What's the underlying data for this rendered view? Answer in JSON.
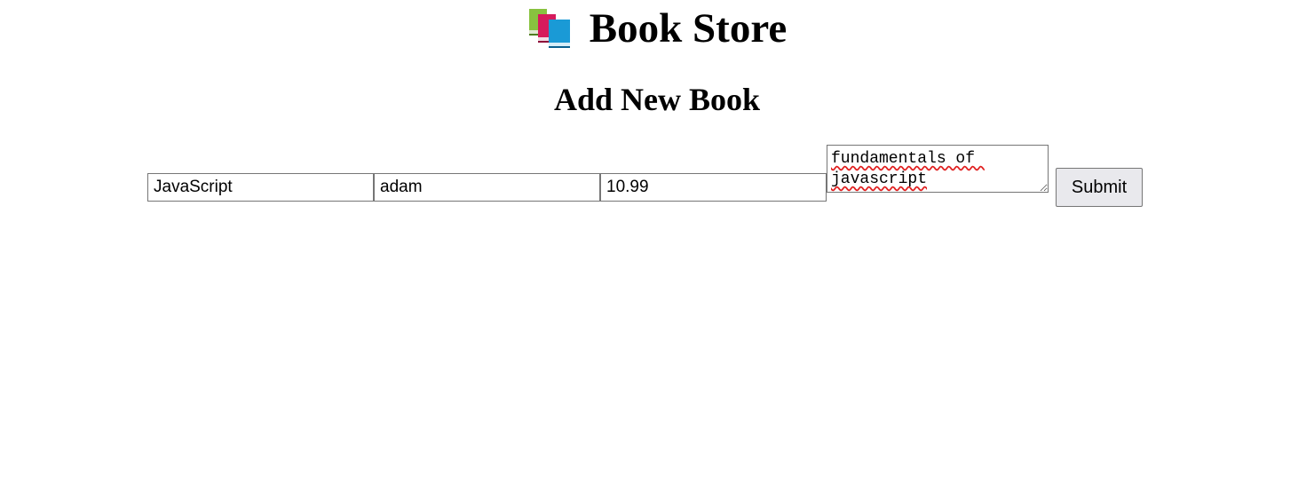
{
  "header": {
    "icon": "books-icon",
    "title": "Book Store"
  },
  "form": {
    "heading": "Add New Book",
    "title_value": "JavaScript",
    "author_value": "adam",
    "price_value": "10.99",
    "description_value": "fundamentals of javascript",
    "submit_label": "Submit"
  }
}
